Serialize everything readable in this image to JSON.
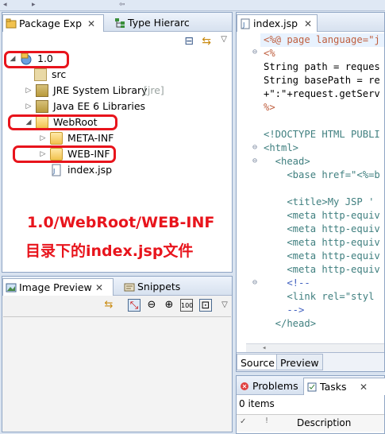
{
  "left_panel": {
    "tab_package": "Package Exp",
    "tab_type": "Type Hierarc",
    "tree": [
      {
        "label": "1.0"
      },
      {
        "label": "src"
      },
      {
        "label": "JRE System Library",
        "decoration": "[jre]"
      },
      {
        "label": "Java EE 6 Libraries"
      },
      {
        "label": "WebRoot"
      },
      {
        "label": "META-INF"
      },
      {
        "label": "WEB-INF"
      },
      {
        "label": "index.jsp"
      }
    ]
  },
  "annotation": {
    "line1": "1.0/WebRoot/WEB-INF",
    "line2": "目录下的index.jsp文件",
    "color": "#e8141c"
  },
  "editor": {
    "tab_label": "index.jsp",
    "lines": [
      "<%@ page language=\"j",
      "<%",
      "String path = reques",
      "String basePath = re",
      "+\":\"+request.getServ",
      "%>",
      "",
      "<!DOCTYPE HTML PUBLI",
      "<html>",
      "  <head>",
      "    <base href=\"<%=b",
      "",
      "    <title>My JSP '",
      "    <meta http-equiv",
      "    <meta http-equiv",
      "    <meta http-equiv",
      "    <meta http-equiv",
      "    <meta http-equiv",
      "    <!--",
      "    <link rel=\"styl",
      "    -->",
      "  </head>"
    ],
    "bottom_tabs": [
      "Source",
      "Preview"
    ]
  },
  "image_preview": {
    "tab_image": "Image Preview",
    "tab_snippets": "Snippets"
  },
  "tasks": {
    "tab_problems": "Problems",
    "tab_tasks": "Tasks",
    "items_count": "0 items",
    "column_description": "Description"
  }
}
